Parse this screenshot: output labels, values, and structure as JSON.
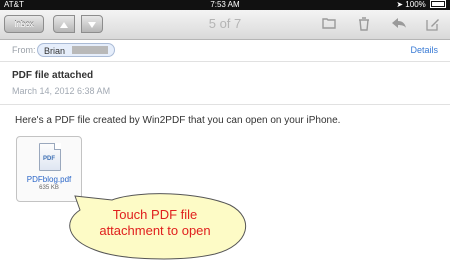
{
  "status": {
    "carrier": "AT&T",
    "time": "7:53 AM",
    "battery": "100%"
  },
  "toolbar": {
    "inbox_label": "Inbox",
    "counter": "5 of 7",
    "up_icon": "chevron-up-icon",
    "down_icon": "chevron-down-icon",
    "icons": [
      "folder-icon",
      "trash-icon",
      "reply-icon",
      "compose-icon"
    ]
  },
  "header": {
    "from_label": "From:",
    "sender_name": "Brian",
    "details_label": "Details"
  },
  "message": {
    "subject": "PDF file attached",
    "date": "March 14, 2012 6:38 AM",
    "body": "Here's a PDF file created by Win2PDF that you can open on your iPhone."
  },
  "attachment": {
    "icon_label": "PDF",
    "filename": "PDFblog.pdf",
    "size": "635 KB"
  },
  "callout": {
    "line1": "Touch PDF file",
    "line2": "attachment to open"
  },
  "colors": {
    "link": "#3a7bd5",
    "callout_text": "#e0201e",
    "callout_fill": "#fdfbc6"
  }
}
